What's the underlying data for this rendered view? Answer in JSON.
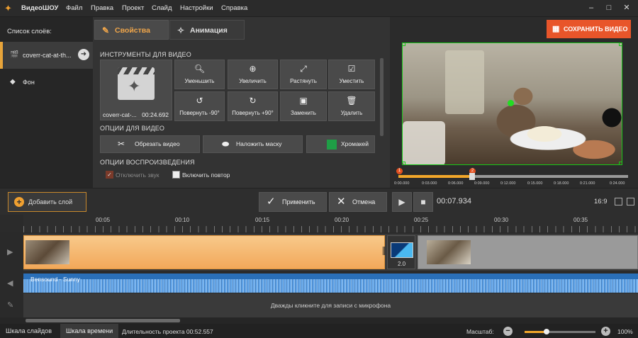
{
  "app": {
    "title": "ВидеоШОУ"
  },
  "menu": [
    "Файл",
    "Правка",
    "Проект",
    "Слайд",
    "Настройки",
    "Справка"
  ],
  "layers": {
    "title": "Список слоёв:",
    "items": [
      {
        "label": "coverr-cat-at-th...",
        "selected": true
      },
      {
        "label": "Фон",
        "selected": false
      }
    ]
  },
  "tabs": {
    "props": "Свойства",
    "anim": "Анимация"
  },
  "video_tools": {
    "section": "ИНСТРУМЕНТЫ ДЛЯ ВИДЕО",
    "clip_name": "coverr-cat-...",
    "clip_duration": "00:24.692",
    "buttons": [
      "Уменьшить",
      "Увеличить",
      "Растянуть",
      "Уместить",
      "Повернуть -90°",
      "Повернуть +90°",
      "Заменить",
      "Удалить"
    ]
  },
  "video_options": {
    "section": "ОПЦИИ ДЛЯ ВИДЕО",
    "crop": "Обрезать видео",
    "mask": "Наложить маску",
    "chroma": "Хромакей"
  },
  "playback": {
    "section": "ОПЦИИ ВОСПРОИЗВЕДЕНИЯ",
    "mute": "Отключить звук",
    "loop": "Включить повтор"
  },
  "save_button": "СОХРАНИТЬ ВИДЕО",
  "mini_ticks": [
    "0:00.000",
    "0:03.000",
    "0:06.000",
    "0:09.000",
    "0:12.000",
    "0:15.000",
    "0:18.000",
    "0:21.000",
    "0:24.000"
  ],
  "mini_markers": [
    "1",
    "2"
  ],
  "toolbar": {
    "add_layer": "Добавить слой",
    "apply": "Применить",
    "cancel": "Отмена",
    "timecode": "00:07.934",
    "ratio": "16:9"
  },
  "ruler": [
    "00:05",
    "00:10",
    "00:15",
    "00:20",
    "00:25",
    "00:30",
    "00:35"
  ],
  "timeline": {
    "transition_duration": "2.0",
    "audio_label": "Bensound - Sunny",
    "mic_hint": "Дважды кликните для записи с микрофона"
  },
  "status": {
    "slides_tab": "Шкала слайдов",
    "timeline_tab": "Шкала времени",
    "duration": "Длительность проекта 00:52.557",
    "scale_label": "Масштаб:",
    "zoom": "100%"
  },
  "colors": {
    "accent": "#f0a64a",
    "save": "#e8552a",
    "selection": "#19c819",
    "audio": "#2a6fb8"
  }
}
